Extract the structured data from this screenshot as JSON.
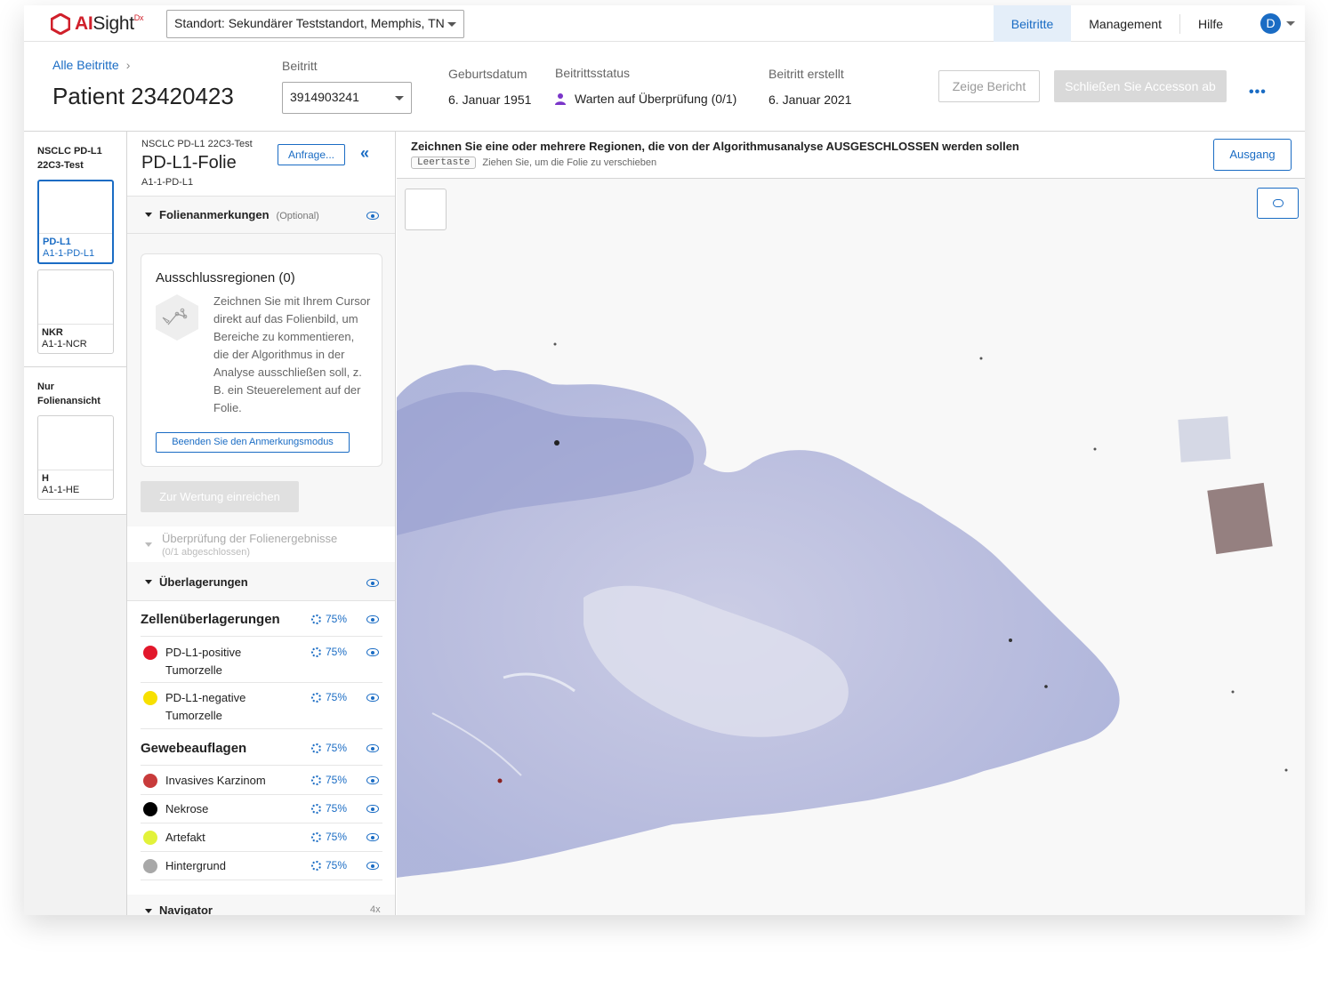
{
  "app": {
    "logo_ai": "AI",
    "logo_sight": "Sight",
    "logo_dx": "Dx",
    "site_select": "Standort: Sekundärer Teststandort, Memphis, TN",
    "nav": [
      "Beitritte",
      "Management",
      "Hilfe"
    ],
    "user_initial": "D",
    "accent_color": "#1a6cc4"
  },
  "header": {
    "breadcrumb": "Alle Beitritte",
    "patient_title": "Patient 23420423",
    "accession_label": "Beitritt",
    "accession_value": "3914903241",
    "dob_label": "Geburtsdatum",
    "dob_value": "6. Januar 1951",
    "status_label": "Beitrittsstatus",
    "status_value": "Warten auf Überprüfung (0/1)",
    "created_label": "Beitritt erstellt",
    "created_value": "6. Januar 2021",
    "report_button": "Zeige Bericht",
    "close_button": "Schließen Sie Accesson ab",
    "more_button": "•••"
  },
  "slides": {
    "group1_title": "NSCLC PD-L1 22C3-Test",
    "slide1_name": "PD-L1",
    "slide1_id": "A1-1-PD-L1",
    "slide2_name": "NKR",
    "slide2_id": "A1-1-NCR",
    "group2_title": "Nur Folienansicht",
    "slide3_name": "H",
    "slide3_id": "A1-1-HE"
  },
  "panel": {
    "test_name": "NSCLC PD-L1 22C3-Test",
    "slide_title": "PD-L1-Folie",
    "slide_id": "A1-1-PD-L1",
    "request_button": "Anfrage...",
    "annotations_label": "Folienanmerkungen",
    "annotations_optional": "(Optional)",
    "exclusion_title": "Ausschlussregionen (0)",
    "exclusion_text": "Zeichnen Sie mit Ihrem Cursor direkt auf das Folienbild, um Bereiche zu kommentieren, die der Algorithmus in der Analyse ausschließen soll, z. B. ein Steuerelement auf der Folie.",
    "end_annotation_button": "Beenden Sie den Anmerkungsmodus",
    "submit_button": "Zur Wertung einreichen",
    "review_title": "Überprüfung der Folienergebnisse",
    "review_sub": "(0/1 abgeschlossen)",
    "overlays_label": "Überlagerungen",
    "cell_overlays_title": "Zellenüberlagerungen",
    "tissue_overlays_title": "Gewebeauflagen",
    "opacity": "75%",
    "cell_items": [
      {
        "label": "PD-L1-positive Tumorzelle",
        "color": "#e2172b"
      },
      {
        "label": "PD-L1-negative Tumorzelle",
        "color": "#f7e000"
      }
    ],
    "tissue_items": [
      {
        "label": "Invasives Karzinom",
        "color": "#c83b3b"
      },
      {
        "label": "Nekrose",
        "color": "#000000"
      },
      {
        "label": "Artefakt",
        "color": "#e2f23a"
      },
      {
        "label": "Hintergrund",
        "color": "#a8a8a8"
      }
    ],
    "navigator_label": "Navigator",
    "navigator_zoom": "4x"
  },
  "viewer": {
    "instruction": "Zeichnen Sie eine oder mehrere Regionen, die von der Algorithmusanalyse AUSGESCHLOSSEN werden sollen",
    "key": "Leertaste",
    "hint": "Ziehen Sie, um die Folie zu verschieben",
    "exit_button": "Ausgang"
  }
}
